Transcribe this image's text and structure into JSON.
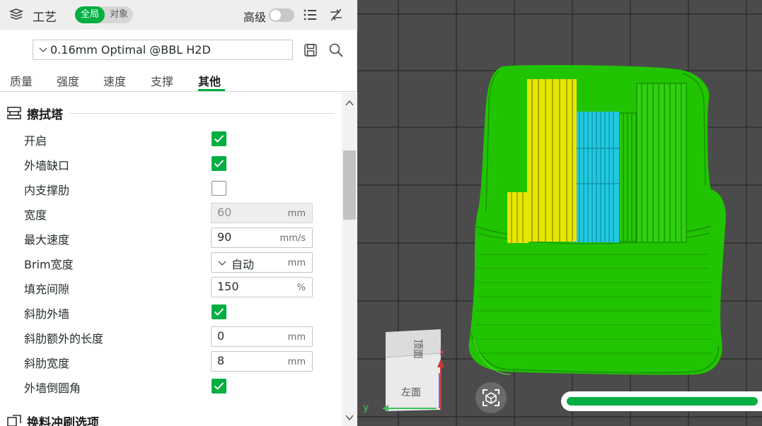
{
  "panel": {
    "title": "工艺",
    "scope_global": "全局",
    "scope_object": "对象",
    "advanced_label": "高级",
    "advanced_on": false,
    "icons": [
      "layers-icon",
      "list-icon",
      "compare-icon",
      "save-icon",
      "search-icon"
    ]
  },
  "preset": {
    "value": "0.16mm Optimal @BBL H2D"
  },
  "tabs": [
    {
      "label": "质量",
      "active": false
    },
    {
      "label": "强度",
      "active": false
    },
    {
      "label": "速度",
      "active": false
    },
    {
      "label": "支撑",
      "active": false
    },
    {
      "label": "其他",
      "active": true
    }
  ],
  "sections": {
    "prime_tower": "擦拭塔",
    "flush": "换料冲刷选项"
  },
  "settings": [
    {
      "label": "开启",
      "type": "checkbox",
      "checked": true
    },
    {
      "label": "外墙缺口",
      "type": "checkbox",
      "checked": true
    },
    {
      "label": "内支撑肋",
      "type": "checkbox",
      "checked": false
    },
    {
      "label": "宽度",
      "type": "input",
      "value": "60",
      "unit": "mm",
      "disabled": true
    },
    {
      "label": "最大速度",
      "type": "input",
      "value": "90",
      "unit": "mm/s"
    },
    {
      "label": "Brim宽度",
      "type": "dropdown",
      "value": "自动",
      "unit": "mm"
    },
    {
      "label": "填充间隙",
      "type": "input",
      "value": "150",
      "unit": "%"
    },
    {
      "label": "斜肋外墙",
      "type": "checkbox",
      "checked": true
    },
    {
      "label": "斜肋额外的长度",
      "type": "input",
      "value": "0",
      "unit": "mm"
    },
    {
      "label": "斜肋宽度",
      "type": "input",
      "value": "8",
      "unit": "mm"
    },
    {
      "label": "外墙倒圆角",
      "type": "checkbox",
      "checked": true
    }
  ],
  "viewport": {
    "view_cube_top": "顶面",
    "view_cube_left": "左面",
    "axis_x": "x",
    "axis_y": "y",
    "colors": {
      "background": "#4b4b4b",
      "grid": "#2e2e2e",
      "wall": "#21c400",
      "yellow_part": "#e6e600",
      "cyan_part": "#21c9e0",
      "accent": "#00ae42"
    },
    "progress": 0.95
  }
}
